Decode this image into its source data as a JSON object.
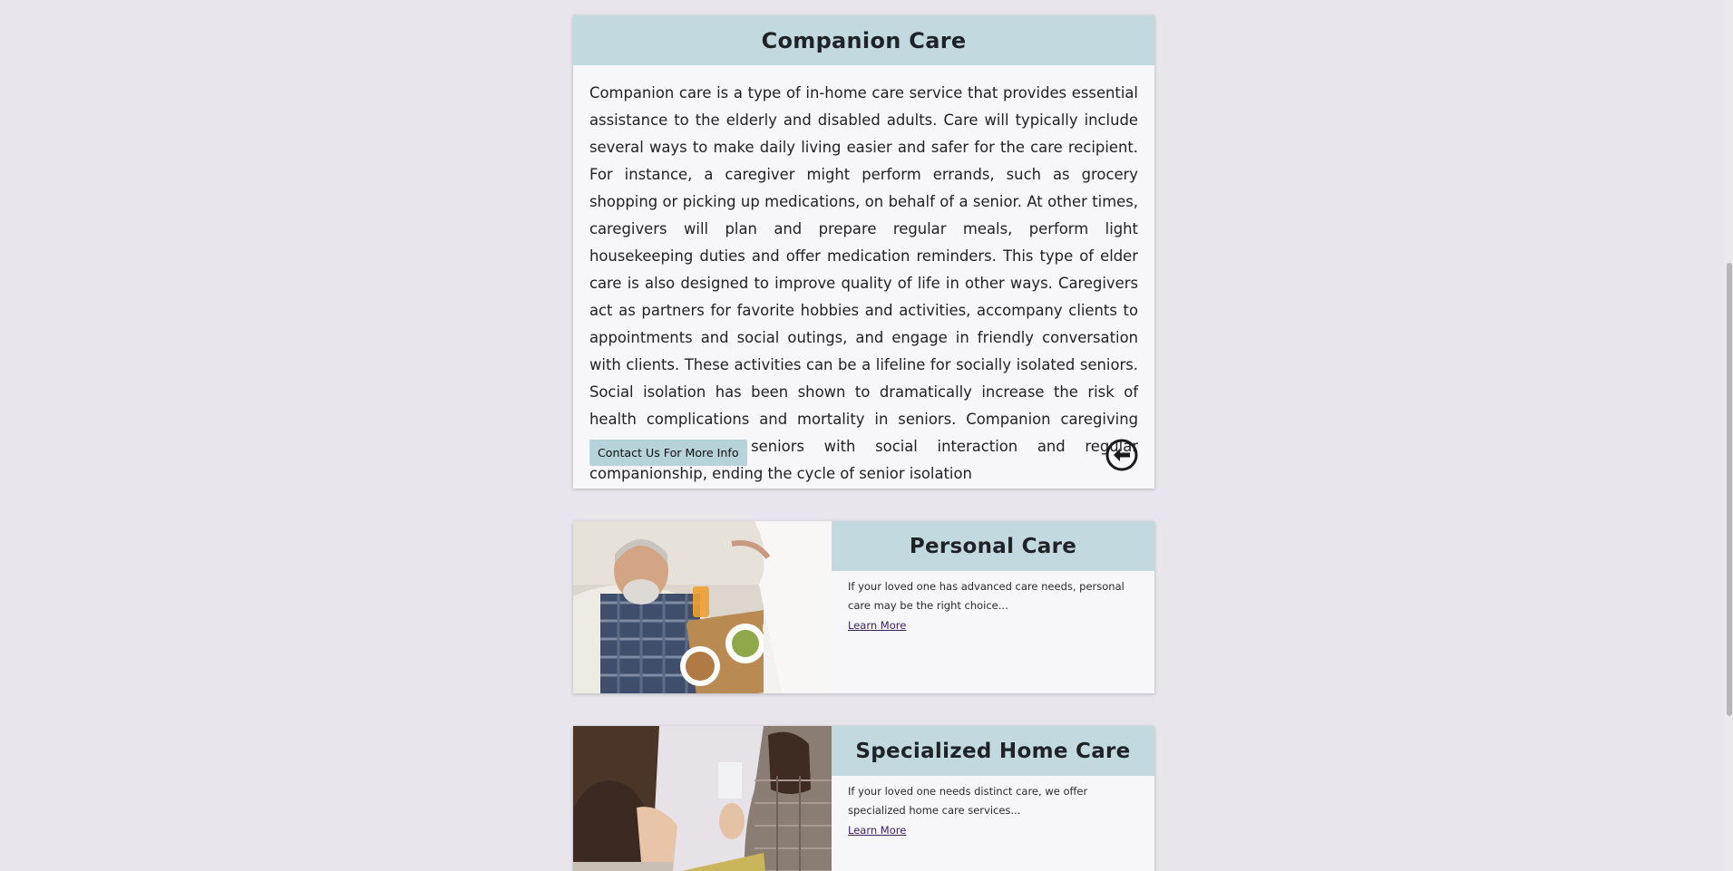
{
  "main_card": {
    "title": "Companion Care",
    "description": "Companion care is a type of in-home care service that provides essential assistance to the elderly and disabled adults. Care will typically include several ways to make daily living easier and safer for the care recipient. For instance, a caregiver might perform errands, such as grocery shopping or picking up medications, on behalf of a senior. At other times, caregivers will plan and prepare regular meals, perform light housekeeping duties and offer medication reminders. This type of elder care is also designed to improve quality of life in other ways. Caregivers act as partners for favorite hobbies and activities, accompany clients to appointments and social outings, and engage in friendly conversation with clients. These activities can be a lifeline for socially isolated seniors. Social isolation has been shown to dramatically increase the risk of health complications and mortality in seniors. Companion caregiving provides isolated seniors with social interaction and regular companionship, ending the cycle of senior isolation",
    "contact_button": "Contact Us For More Info",
    "back_icon": "arrow-left-circle-icon"
  },
  "services": [
    {
      "title": "Personal Care",
      "text": "If your loved one has advanced care needs, personal care may be the right choice...",
      "link": "Learn More",
      "image": "elderly-man-in-bed-with-breakfast-tray"
    },
    {
      "title": "Specialized Home Care",
      "text": "If your loved one needs distinct care, we offer specialized home care services...",
      "link": "Learn More",
      "image": "two-women-in-conversation"
    }
  ],
  "colors": {
    "page_background": "#e8e6ec",
    "header_background": "#c2dadf",
    "card_background": "#f7f7fa",
    "button_background": "#b7d3da",
    "link_color": "#3a1e5a"
  }
}
